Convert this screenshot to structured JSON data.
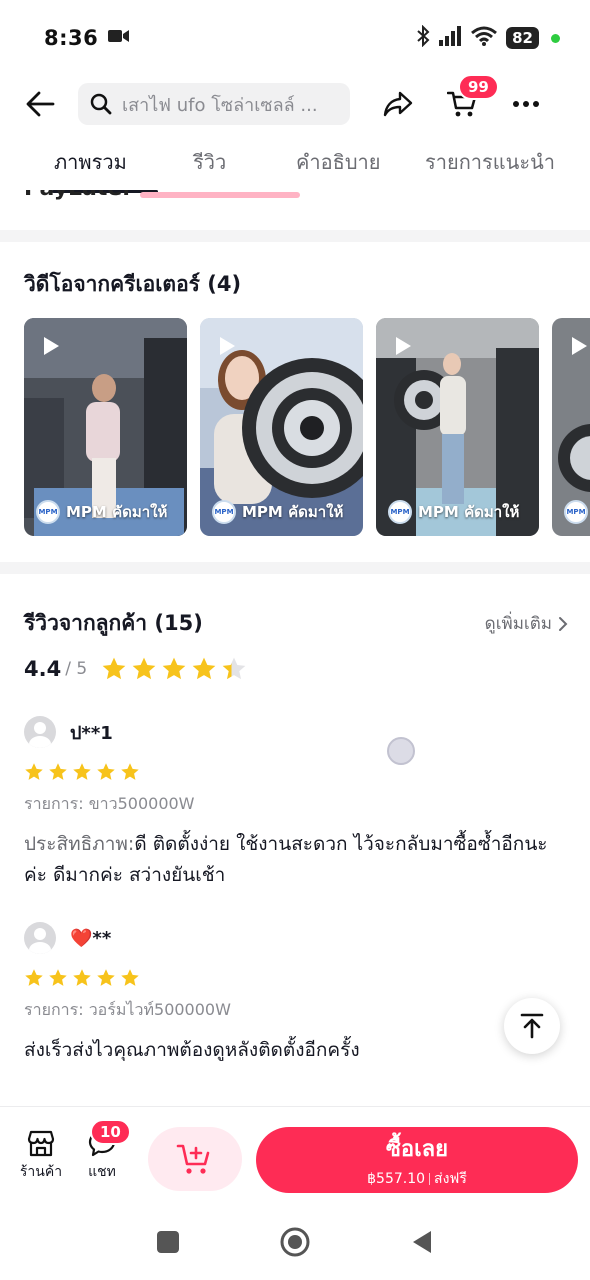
{
  "status_bar": {
    "time": "8:36",
    "battery": "82"
  },
  "header": {
    "search_placeholder": "เสาไฟ ufo โซล่าเซลล์ ...",
    "cart_badge": "99"
  },
  "tabs": [
    {
      "label": "ภาพรวม",
      "active": true
    },
    {
      "label": "รีวิว",
      "active": false
    },
    {
      "label": "คำอธิบาย",
      "active": false
    },
    {
      "label": "รายการแนะนำ",
      "active": false
    }
  ],
  "cut_row": {
    "label": "PayLater"
  },
  "videos": {
    "title": "วิดีโอจากครีเอเตอร์ (4)",
    "items": [
      {
        "caption": "MPM คัดมาให้"
      },
      {
        "caption": "MPM คัดมาให้"
      },
      {
        "caption": "MPM คัดมาให้"
      },
      {
        "caption": ""
      }
    ]
  },
  "reviews": {
    "title": "รีวิวจากลูกค้า (15)",
    "see_more": "ดูเพิ่มเติม",
    "rating": "4.4",
    "rating_of": "/ 5",
    "rating_value": 4.4,
    "items": [
      {
        "name": "ป**1",
        "stars": 5,
        "variant": "รายการ: ขาว500000W",
        "label": "ประสิทธิภาพ:",
        "text": "ดี ติดตั้งง่าย ใช้งานสะดวก ไว้จะกลับมาซื้อซ้ำอีกนะค่ะ ดีมากค่ะ สว่างยันเช้า"
      },
      {
        "name": "❤️**",
        "stars": 5,
        "variant": "รายการ: วอร์มไวท์500000W",
        "label": "",
        "text": "ส่งเร็วส่งไวคุณภาพต้องดูหลังติดตั้งอีกครั้ง"
      }
    ]
  },
  "bottom_bar": {
    "shop_label": "ร้านค้า",
    "chat_label": "แชท",
    "chat_badge": "10",
    "buy_label": "ซื้อเลย",
    "price": "฿557.10",
    "shipping": "ส่งฟรี"
  },
  "colors": {
    "accent": "#fe2c55",
    "star": "#f7c31b"
  }
}
